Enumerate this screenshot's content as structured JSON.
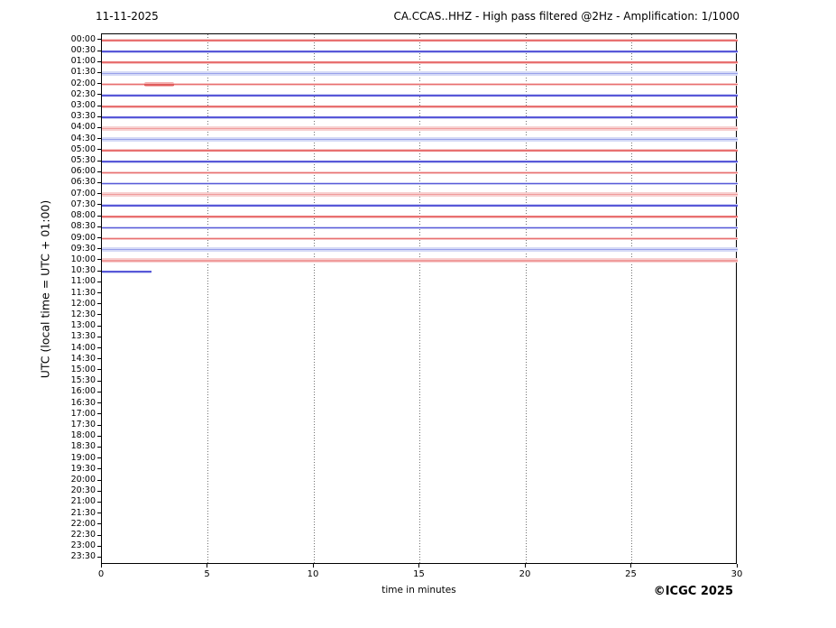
{
  "header": {
    "date": "11-11-2025",
    "title": "CA.CCAS..HHZ - High pass filtered @2Hz - Amplification: 1/1000"
  },
  "axes": {
    "y_label": "UTC (local time = UTC + 01:00)",
    "x_label": "time in minutes",
    "x_ticks": [
      "0",
      "5",
      "10",
      "15",
      "20",
      "25",
      "30"
    ],
    "x_range_minutes": [
      0,
      30
    ],
    "gridline_minutes": [
      5,
      10,
      15,
      20,
      25
    ],
    "grid": "vertical dotted"
  },
  "footer": {
    "copyright": "©ICGC 2025"
  },
  "colors": {
    "background": "#ffffff",
    "axis": "#000000",
    "grid": "#707070",
    "red_core": "#e87070",
    "red_band": "#f7caca",
    "red_light_core": "#f09c9c",
    "red_light_band": "#f7d0d0",
    "blue_core": "#5858d8",
    "blue_band": "#cdd2f4",
    "blue_light_core": "#98a0ea",
    "blue_light_band": "#d5daf6",
    "event_core": "#e05c5c",
    "event_band": "#f3b0b0"
  },
  "chart_data": {
    "type": "line",
    "title": "CA.CCAS..HHZ - High pass filtered @2Hz - Amplification: 1/1000",
    "subtitle_date": "11-11-2025",
    "xlabel": "time in minutes",
    "ylabel": "UTC (local time = UTC + 01:00)",
    "xlim": [
      0,
      30
    ],
    "row_duration_minutes": 30,
    "rows_total": 48,
    "rows": [
      {
        "label": "00:00",
        "color": "red",
        "noise": "quiet",
        "coverage_min": 30
      },
      {
        "label": "00:30",
        "color": "blue",
        "noise": "quiet",
        "coverage_min": 30
      },
      {
        "label": "01:00",
        "color": "red",
        "noise": "quiet",
        "coverage_min": 30
      },
      {
        "label": "01:30",
        "color": "blue",
        "noise": "elevated",
        "coverage_min": 30
      },
      {
        "label": "02:00",
        "color": "red",
        "noise": "quiet",
        "coverage_min": 30
      },
      {
        "label": "02:30",
        "color": "blue",
        "noise": "quiet",
        "coverage_min": 30
      },
      {
        "label": "03:00",
        "color": "red",
        "noise": "quiet",
        "coverage_min": 30
      },
      {
        "label": "03:30",
        "color": "blue",
        "noise": "quiet",
        "coverage_min": 30
      },
      {
        "label": "04:00",
        "color": "red",
        "noise": "elevated",
        "coverage_min": 30
      },
      {
        "label": "04:30",
        "color": "blue",
        "noise": "elevated",
        "coverage_min": 30
      },
      {
        "label": "05:00",
        "color": "red",
        "noise": "quiet",
        "coverage_min": 30
      },
      {
        "label": "05:30",
        "color": "blue",
        "noise": "quiet",
        "coverage_min": 30
      },
      {
        "label": "06:00",
        "color": "red",
        "noise": "quiet",
        "coverage_min": 30
      },
      {
        "label": "06:30",
        "color": "blue",
        "noise": "quiet",
        "coverage_min": 30
      },
      {
        "label": "07:00",
        "color": "red",
        "noise": "elevated",
        "coverage_min": 30
      },
      {
        "label": "07:30",
        "color": "blue",
        "noise": "quiet",
        "coverage_min": 30
      },
      {
        "label": "08:00",
        "color": "red",
        "noise": "quiet",
        "coverage_min": 30
      },
      {
        "label": "08:30",
        "color": "blue",
        "noise": "quiet",
        "coverage_min": 30
      },
      {
        "label": "09:00",
        "color": "red",
        "noise": "quiet",
        "coverage_min": 30
      },
      {
        "label": "09:30",
        "color": "blue",
        "noise": "elevated",
        "coverage_min": 30
      },
      {
        "label": "10:00",
        "color": "red",
        "noise": "elevated",
        "coverage_min": 30
      },
      {
        "label": "10:30",
        "color": "blue",
        "noise": "quiet",
        "coverage_min": 2.35
      },
      {
        "label": "11:00",
        "color": null,
        "noise": null,
        "coverage_min": 0
      },
      {
        "label": "11:30",
        "color": null,
        "noise": null,
        "coverage_min": 0
      },
      {
        "label": "12:00",
        "color": null,
        "noise": null,
        "coverage_min": 0
      },
      {
        "label": "12:30",
        "color": null,
        "noise": null,
        "coverage_min": 0
      },
      {
        "label": "13:00",
        "color": null,
        "noise": null,
        "coverage_min": 0
      },
      {
        "label": "13:30",
        "color": null,
        "noise": null,
        "coverage_min": 0
      },
      {
        "label": "14:00",
        "color": null,
        "noise": null,
        "coverage_min": 0
      },
      {
        "label": "14:30",
        "color": null,
        "noise": null,
        "coverage_min": 0
      },
      {
        "label": "15:00",
        "color": null,
        "noise": null,
        "coverage_min": 0
      },
      {
        "label": "15:30",
        "color": null,
        "noise": null,
        "coverage_min": 0
      },
      {
        "label": "16:00",
        "color": null,
        "noise": null,
        "coverage_min": 0
      },
      {
        "label": "16:30",
        "color": null,
        "noise": null,
        "coverage_min": 0
      },
      {
        "label": "17:00",
        "color": null,
        "noise": null,
        "coverage_min": 0
      },
      {
        "label": "17:30",
        "color": null,
        "noise": null,
        "coverage_min": 0
      },
      {
        "label": "18:00",
        "color": null,
        "noise": null,
        "coverage_min": 0
      },
      {
        "label": "18:30",
        "color": null,
        "noise": null,
        "coverage_min": 0
      },
      {
        "label": "19:00",
        "color": null,
        "noise": null,
        "coverage_min": 0
      },
      {
        "label": "19:30",
        "color": null,
        "noise": null,
        "coverage_min": 0
      },
      {
        "label": "20:00",
        "color": null,
        "noise": null,
        "coverage_min": 0
      },
      {
        "label": "20:30",
        "color": null,
        "noise": null,
        "coverage_min": 0
      },
      {
        "label": "21:00",
        "color": null,
        "noise": null,
        "coverage_min": 0
      },
      {
        "label": "21:30",
        "color": null,
        "noise": null,
        "coverage_min": 0
      },
      {
        "label": "22:00",
        "color": null,
        "noise": null,
        "coverage_min": 0
      },
      {
        "label": "22:30",
        "color": null,
        "noise": null,
        "coverage_min": 0
      },
      {
        "label": "23:00",
        "color": null,
        "noise": null,
        "coverage_min": 0
      },
      {
        "label": "23:30",
        "color": null,
        "noise": null,
        "coverage_min": 0
      }
    ],
    "events": [
      {
        "row_label": "02:00",
        "start_min": 2.0,
        "end_min": 3.4,
        "description": "small amplitude burst"
      }
    ],
    "legend": "none"
  }
}
